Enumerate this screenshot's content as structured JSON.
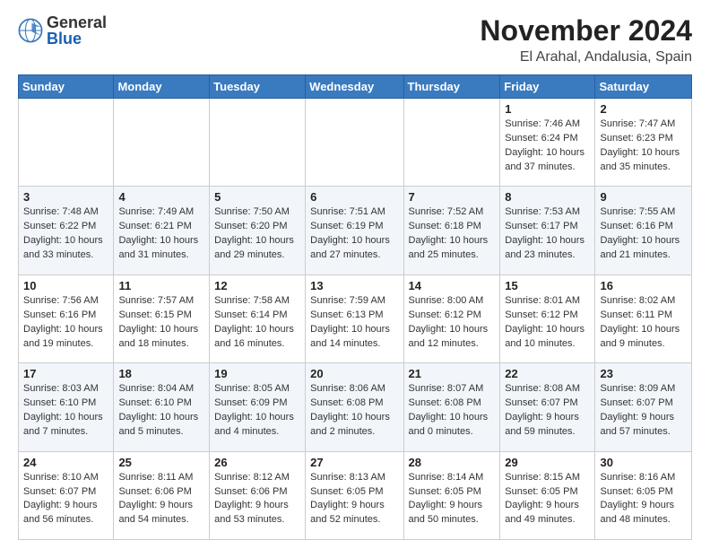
{
  "logo": {
    "general": "General",
    "blue": "Blue"
  },
  "header": {
    "month": "November 2024",
    "location": "El Arahal, Andalusia, Spain"
  },
  "weekdays": [
    "Sunday",
    "Monday",
    "Tuesday",
    "Wednesday",
    "Thursday",
    "Friday",
    "Saturday"
  ],
  "weeks": [
    [
      {
        "day": "",
        "text": ""
      },
      {
        "day": "",
        "text": ""
      },
      {
        "day": "",
        "text": ""
      },
      {
        "day": "",
        "text": ""
      },
      {
        "day": "",
        "text": ""
      },
      {
        "day": "1",
        "text": "Sunrise: 7:46 AM\nSunset: 6:24 PM\nDaylight: 10 hours and 37 minutes."
      },
      {
        "day": "2",
        "text": "Sunrise: 7:47 AM\nSunset: 6:23 PM\nDaylight: 10 hours and 35 minutes."
      }
    ],
    [
      {
        "day": "3",
        "text": "Sunrise: 7:48 AM\nSunset: 6:22 PM\nDaylight: 10 hours and 33 minutes."
      },
      {
        "day": "4",
        "text": "Sunrise: 7:49 AM\nSunset: 6:21 PM\nDaylight: 10 hours and 31 minutes."
      },
      {
        "day": "5",
        "text": "Sunrise: 7:50 AM\nSunset: 6:20 PM\nDaylight: 10 hours and 29 minutes."
      },
      {
        "day": "6",
        "text": "Sunrise: 7:51 AM\nSunset: 6:19 PM\nDaylight: 10 hours and 27 minutes."
      },
      {
        "day": "7",
        "text": "Sunrise: 7:52 AM\nSunset: 6:18 PM\nDaylight: 10 hours and 25 minutes."
      },
      {
        "day": "8",
        "text": "Sunrise: 7:53 AM\nSunset: 6:17 PM\nDaylight: 10 hours and 23 minutes."
      },
      {
        "day": "9",
        "text": "Sunrise: 7:55 AM\nSunset: 6:16 PM\nDaylight: 10 hours and 21 minutes."
      }
    ],
    [
      {
        "day": "10",
        "text": "Sunrise: 7:56 AM\nSunset: 6:16 PM\nDaylight: 10 hours and 19 minutes."
      },
      {
        "day": "11",
        "text": "Sunrise: 7:57 AM\nSunset: 6:15 PM\nDaylight: 10 hours and 18 minutes."
      },
      {
        "day": "12",
        "text": "Sunrise: 7:58 AM\nSunset: 6:14 PM\nDaylight: 10 hours and 16 minutes."
      },
      {
        "day": "13",
        "text": "Sunrise: 7:59 AM\nSunset: 6:13 PM\nDaylight: 10 hours and 14 minutes."
      },
      {
        "day": "14",
        "text": "Sunrise: 8:00 AM\nSunset: 6:12 PM\nDaylight: 10 hours and 12 minutes."
      },
      {
        "day": "15",
        "text": "Sunrise: 8:01 AM\nSunset: 6:12 PM\nDaylight: 10 hours and 10 minutes."
      },
      {
        "day": "16",
        "text": "Sunrise: 8:02 AM\nSunset: 6:11 PM\nDaylight: 10 hours and 9 minutes."
      }
    ],
    [
      {
        "day": "17",
        "text": "Sunrise: 8:03 AM\nSunset: 6:10 PM\nDaylight: 10 hours and 7 minutes."
      },
      {
        "day": "18",
        "text": "Sunrise: 8:04 AM\nSunset: 6:10 PM\nDaylight: 10 hours and 5 minutes."
      },
      {
        "day": "19",
        "text": "Sunrise: 8:05 AM\nSunset: 6:09 PM\nDaylight: 10 hours and 4 minutes."
      },
      {
        "day": "20",
        "text": "Sunrise: 8:06 AM\nSunset: 6:08 PM\nDaylight: 10 hours and 2 minutes."
      },
      {
        "day": "21",
        "text": "Sunrise: 8:07 AM\nSunset: 6:08 PM\nDaylight: 10 hours and 0 minutes."
      },
      {
        "day": "22",
        "text": "Sunrise: 8:08 AM\nSunset: 6:07 PM\nDaylight: 9 hours and 59 minutes."
      },
      {
        "day": "23",
        "text": "Sunrise: 8:09 AM\nSunset: 6:07 PM\nDaylight: 9 hours and 57 minutes."
      }
    ],
    [
      {
        "day": "24",
        "text": "Sunrise: 8:10 AM\nSunset: 6:07 PM\nDaylight: 9 hours and 56 minutes."
      },
      {
        "day": "25",
        "text": "Sunrise: 8:11 AM\nSunset: 6:06 PM\nDaylight: 9 hours and 54 minutes."
      },
      {
        "day": "26",
        "text": "Sunrise: 8:12 AM\nSunset: 6:06 PM\nDaylight: 9 hours and 53 minutes."
      },
      {
        "day": "27",
        "text": "Sunrise: 8:13 AM\nSunset: 6:05 PM\nDaylight: 9 hours and 52 minutes."
      },
      {
        "day": "28",
        "text": "Sunrise: 8:14 AM\nSunset: 6:05 PM\nDaylight: 9 hours and 50 minutes."
      },
      {
        "day": "29",
        "text": "Sunrise: 8:15 AM\nSunset: 6:05 PM\nDaylight: 9 hours and 49 minutes."
      },
      {
        "day": "30",
        "text": "Sunrise: 8:16 AM\nSunset: 6:05 PM\nDaylight: 9 hours and 48 minutes."
      }
    ]
  ]
}
